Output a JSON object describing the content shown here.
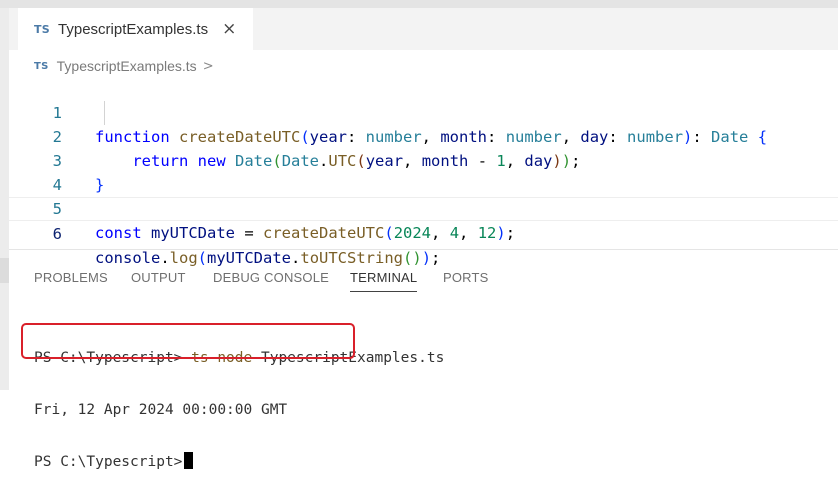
{
  "tab": {
    "badge": "TS",
    "title": "TypescriptExamples.ts",
    "close": "×"
  },
  "breadcrumb": {
    "badge": "TS",
    "file": "TypescriptExamples.ts",
    "chevron": ">"
  },
  "editor": {
    "lines": [
      {
        "num": "1"
      },
      {
        "num": "2"
      },
      {
        "num": "3"
      },
      {
        "num": "4"
      },
      {
        "num": "5"
      },
      {
        "num": "6"
      }
    ]
  },
  "panel": {
    "tabs": [
      "PROBLEMS",
      "OUTPUT",
      "DEBUG CONSOLE",
      "TERMINAL",
      "PORTS"
    ],
    "active_tab": "TERMINAL"
  },
  "terminal": {
    "prompt": "PS C:\\Typescript>",
    "command": "ts-node",
    "command_arg": "TypescriptExamples.ts",
    "output": "Fri, 12 Apr 2024 00:00:00 GMT"
  }
}
